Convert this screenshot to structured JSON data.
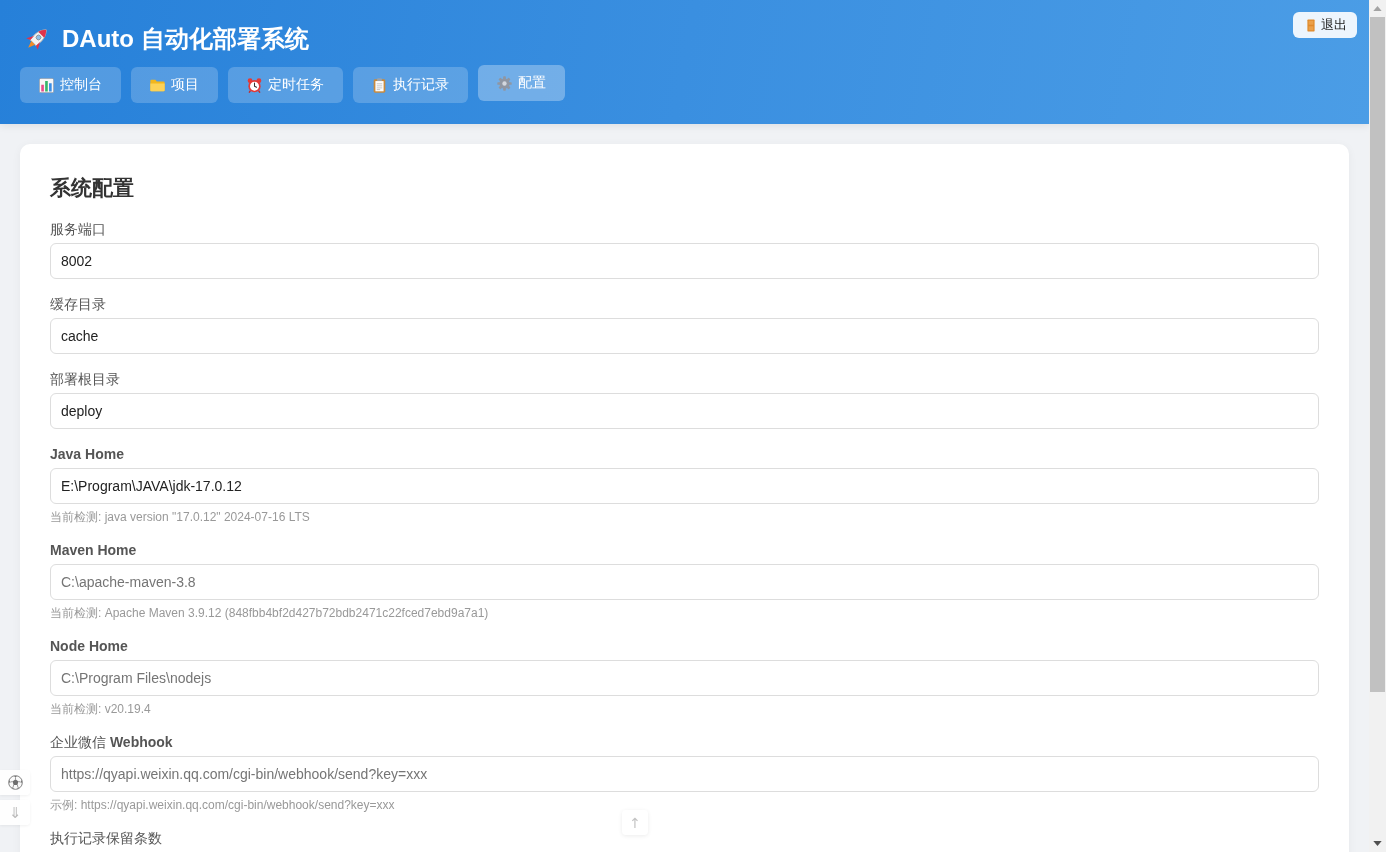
{
  "header": {
    "title": "DAuto 自动化部署系统",
    "nav": [
      {
        "label": "控制台",
        "selected": false
      },
      {
        "label": "项目",
        "selected": false
      },
      {
        "label": "定时任务",
        "selected": false
      },
      {
        "label": "执行记录",
        "selected": false
      },
      {
        "label": "配置",
        "selected": true
      }
    ],
    "logout": {
      "label": "退出"
    }
  },
  "config": {
    "title": "系统配置",
    "fields": [
      {
        "label": "服务端口",
        "value": "8002"
      },
      {
        "label": "缓存目录",
        "value": "cache"
      },
      {
        "label": "部署根目录",
        "value": "deploy"
      },
      {
        "label": "Java Home",
        "value": "E:\\Program\\JAVA\\jdk-17.0.12",
        "hint": "当前检测: java version \"17.0.12\" 2024-07-16 LTS"
      },
      {
        "label": "Maven Home",
        "placeholder": "C:\\apache-maven-3.8",
        "hint": "当前检测: Apache Maven 3.9.12 (848fbb4bf2d427b72bdb2471c22fced7ebd9a7a1)"
      },
      {
        "label": "Node Home",
        "placeholder": "C:\\Program Files\\nodejs",
        "hint": "当前检测: v20.19.4"
      },
      {
        "label": "企业微信 Webhook",
        "placeholder": "https://qyapi.weixin.qq.com/cgi-bin/webhook/send?key=xxx",
        "hint": "示例: https://qyapi.weixin.qq.com/cgi-bin/webhook/send?key=xxx"
      },
      {
        "label": "执行记录保留条数"
      }
    ]
  },
  "side_tools": [
    {
      "kind": "icon"
    },
    {
      "kind": "glyph",
      "text": "⇓"
    }
  ],
  "back_to_top": {
    "text": "↑"
  }
}
